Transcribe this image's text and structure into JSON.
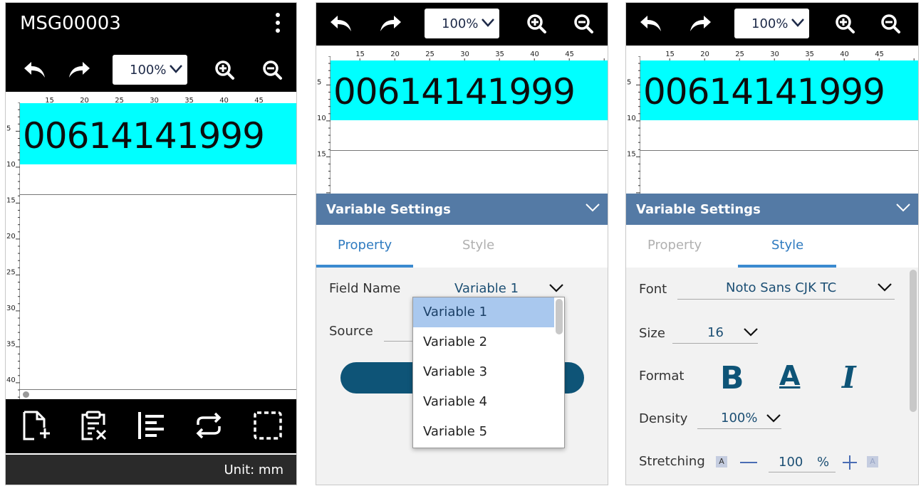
{
  "screen1": {
    "title": "MSG00003",
    "zoom": "100%",
    "ruler_labels": [
      "15",
      "20",
      "25",
      "30",
      "35",
      "40",
      "45"
    ],
    "vruler_labels": [
      "5",
      "10",
      "15",
      "20",
      "25",
      "30",
      "35",
      "40"
    ],
    "barcode_text": "00614141999",
    "unit": "Unit: mm",
    "bottom_icons": [
      "new-file-icon",
      "clipboard-icon",
      "align-icon",
      "repeat-icon",
      "select-area-icon"
    ]
  },
  "screen2": {
    "zoom": "100%",
    "ruler_labels": [
      "15",
      "20",
      "25",
      "30",
      "35",
      "40",
      "45"
    ],
    "vruler_labels": [
      "5",
      "10",
      "15"
    ],
    "barcode_text": "00614141999",
    "panel_title": "Variable Settings",
    "tabs": [
      "Property",
      "Style"
    ],
    "field_name_label": "Field Name",
    "field_name_value": "Variable 1",
    "source_label": "Source",
    "dropdown_options": [
      "Variable 1",
      "Variable 2",
      "Variable 3",
      "Variable 4",
      "Variable 5"
    ]
  },
  "screen3": {
    "zoom": "100%",
    "ruler_labels": [
      "15",
      "20",
      "25",
      "30",
      "35",
      "40",
      "45"
    ],
    "vruler_labels": [
      "5",
      "10",
      "15"
    ],
    "barcode_text": "00614141999",
    "panel_title": "Variable Settings",
    "tabs": [
      "Property",
      "Style"
    ],
    "font_label": "Font",
    "font_value": "Noto Sans CJK TC",
    "size_label": "Size",
    "size_value": "16",
    "format_label": "Format",
    "format_bold": "B",
    "format_underline": "A",
    "format_italic": "I",
    "density_label": "Density",
    "density_value": "100%",
    "stretching_label": "Stretching",
    "stretching_value": "100",
    "stretching_unit": "%",
    "stretch_box_left": "A",
    "stretch_box_right": "A"
  },
  "colors": {
    "highlight": "#00ffff",
    "header": "#547aa5",
    "accent": "#0e5477",
    "tab_active": "#2f7bc0"
  }
}
